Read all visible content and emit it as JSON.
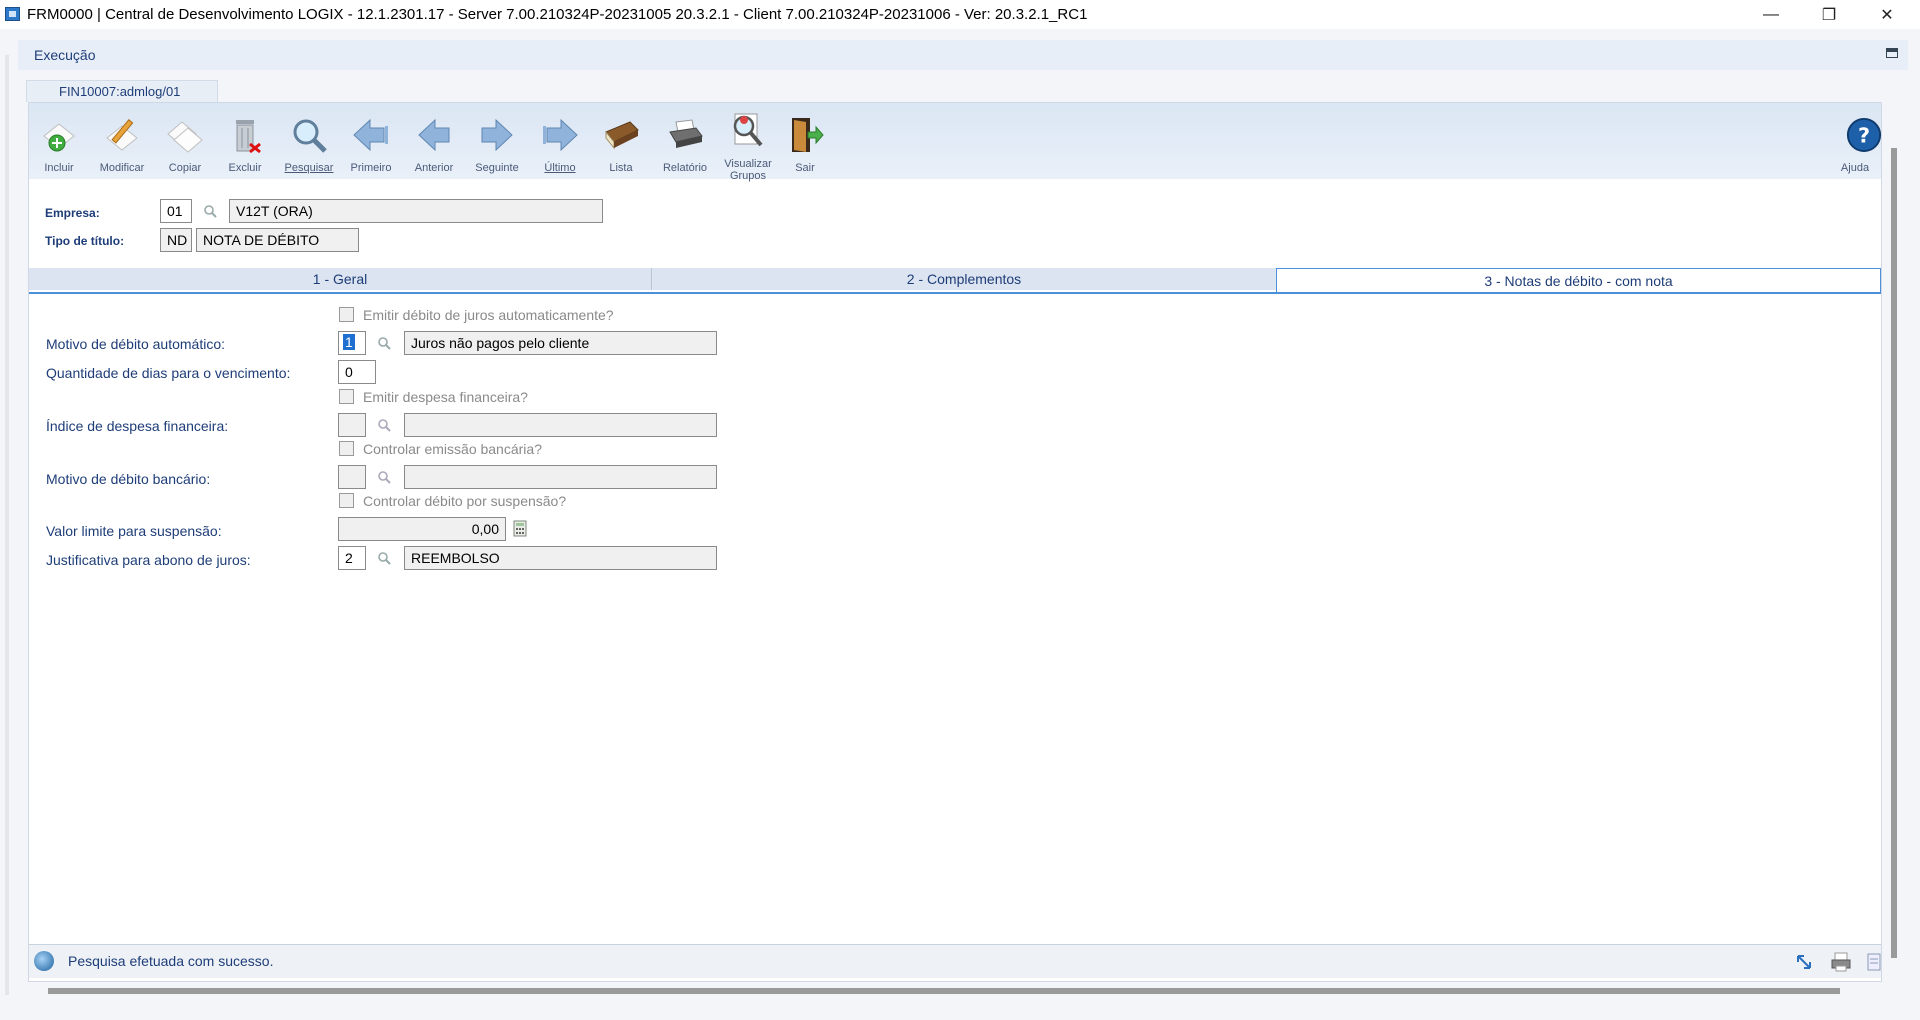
{
  "window": {
    "title": "FRM0000 | Central de Desenvolvimento LOGIX  -  12.1.2301.17 - Server 7.00.210324P-20231005 20.3.2.1 - Client 7.00.210324P-20231006 - Ver: 20.3.2.1_RC1",
    "minimize": "—",
    "restore": "❐",
    "close": "✕"
  },
  "exec": {
    "label": "Execução"
  },
  "doc_tab": {
    "label": "FIN10007:admlog/01"
  },
  "toolbar": {
    "incluir": "Incluir",
    "modificar": "Modificar",
    "copiar": "Copiar",
    "excluir": "Excluir",
    "pesquisar": "Pesquisar",
    "primeiro": "Primeiro",
    "anterior": "Anterior",
    "seguinte": "Seguinte",
    "ultimo": "Último",
    "lista": "Lista",
    "relatorio": "Relatório",
    "visualizar_1": "Visualizar",
    "visualizar_2": "Grupos",
    "sair": "Sair",
    "ajuda": "Ajuda"
  },
  "header": {
    "empresa_label": "Empresa:",
    "empresa_code": "01",
    "empresa_name": "V12T (ORA)",
    "tipo_label": "Tipo de título:",
    "tipo_code": "ND",
    "tipo_name": "NOTA DE DÉBITO"
  },
  "subtabs": {
    "geral": "1 - Geral",
    "complementos": "2 - Complementos",
    "notas": "3 - Notas de débito - com nota"
  },
  "form": {
    "chk_juros": "Emitir débito de juros automaticamente?",
    "motivo_label": "Motivo de débito automático:",
    "motivo_code": "1",
    "motivo_desc": "Juros não pagos pelo cliente",
    "dias_label": "Quantidade de dias para o vencimento:",
    "dias_value": "0",
    "chk_despesa": "Emitir despesa financeira?",
    "indice_label": "Índice de despesa financeira:",
    "indice_code": "",
    "indice_desc": "",
    "chk_emissao": "Controlar emissão bancária?",
    "banc_label": "Motivo de débito bancário:",
    "banc_code": "",
    "banc_desc": "",
    "chk_suspensao": "Controlar débito por suspensão?",
    "valor_label": "Valor limite para suspensão:",
    "valor_value": "0,00",
    "justif_label": "Justificativa para abono de juros:",
    "justif_code": "2",
    "justif_desc": "REEMBOLSO"
  },
  "status": {
    "message": "Pesquisa efetuada com sucesso."
  }
}
